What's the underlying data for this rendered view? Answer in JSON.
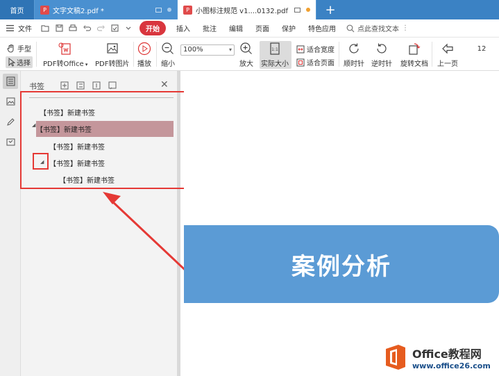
{
  "tabs": [
    {
      "title": "首页"
    },
    {
      "title": "文字文稿2.pdf *"
    },
    {
      "title": "小图标注规范 v1....0132.pdf *"
    }
  ],
  "add_tab": "+",
  "menu": {
    "file": "文件",
    "start": "开始",
    "items": [
      "插入",
      "批注",
      "编辑",
      "页面",
      "保护",
      "特色应用"
    ],
    "search": "点此查找文本"
  },
  "toolbar": {
    "hand": "手型",
    "select": "选择",
    "pdf_to_office": "PDF转Office",
    "pdf_to_image": "PDF转图片",
    "play": "播放",
    "zoom_out": "缩小",
    "zoom_value": "100%",
    "zoom_in": "放大",
    "actual_size": "实际大小",
    "fit_width": "适合宽度",
    "fit_page": "适合页面",
    "rotate_cw": "顺时针",
    "rotate_ccw": "逆时针",
    "rotate_doc": "旋转文档",
    "prev_page": "上一页",
    "page_number": "12"
  },
  "bookmark_panel": {
    "title": "书签",
    "items": [
      {
        "label": "【书签】新建书签",
        "level": 0,
        "expanded": false,
        "selected": false
      },
      {
        "label": "【书签】新建书签",
        "level": 0,
        "expanded": true,
        "selected": true
      },
      {
        "label": "【书签】新建书签",
        "level": 1,
        "expanded": false,
        "selected": false
      },
      {
        "label": "【书签】新建书签",
        "level": 1,
        "expanded": true,
        "selected": false
      },
      {
        "label": "【书签】新建书签",
        "level": 2,
        "expanded": false,
        "selected": false
      }
    ]
  },
  "document": {
    "banner_text": "案例分析"
  },
  "watermark": {
    "line1": "Office教程网",
    "line2": "www.office26.com"
  },
  "colors": {
    "tabbar": "#3b82c4",
    "start_button": "#d9363e",
    "selected_bookmark": "#c4969b",
    "annotation_red": "#e53935",
    "banner": "#5b9bd5"
  }
}
